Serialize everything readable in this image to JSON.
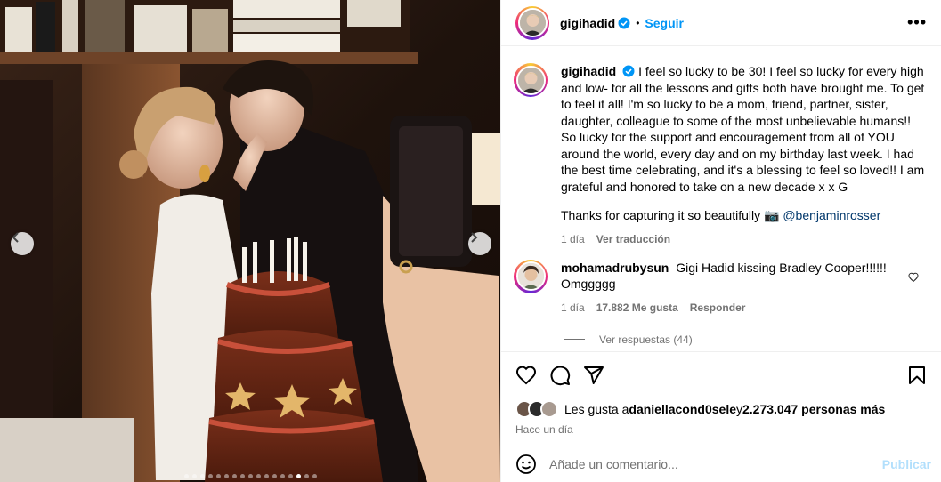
{
  "post": {
    "username": "gigihadid",
    "follow_label": "Seguir",
    "more_label": "•••",
    "caption": "I feel so lucky to be 30! I feel so lucky for every high and low- for all the lessons and gifts both have brought me. To get to feel it all! I'm so lucky to be a mom, friend, partner, sister, daughter, colleague to some of the most unbelievable humans!! So lucky for the support and encouragement from all of YOU around the world, every day and on my birthday last week. I had the best time celebrating, and it's a blessing to feel so loved!! I am grateful and honored to take on a new decade x x G",
    "thanks_text": "Thanks for capturing it so beautifully 📷 ",
    "mention": "@benjaminrosser",
    "caption_age": "1 día",
    "translate_label": "Ver traducción"
  },
  "comment": {
    "username": "mohamadrubysun",
    "text": "Gigi Hadid kissing Bradley Cooper!!!!!! Omggggg",
    "age": "1 día",
    "likes": "17.882 Me gusta",
    "reply_label": "Responder",
    "replies_label": "Ver respuestas (44)"
  },
  "likes": {
    "prefix": "Les gusta a ",
    "first_user": "daniellacond0sele",
    "middle": " y ",
    "count": "2.273.047 personas más"
  },
  "timestamp": "Hace un día",
  "add_comment": {
    "placeholder": "Añade un comentario...",
    "publish_label": "Publicar"
  },
  "carousel": {
    "slide_count": 17,
    "active_index": 14
  },
  "colors": {
    "accent": "#0095f6",
    "mention": "#00376b",
    "muted": "#737373",
    "publish_disabled": "#b2dffc"
  },
  "icons": [
    "verified-badge-icon",
    "more-options-icon",
    "heart-icon",
    "comment-icon",
    "share-icon",
    "bookmark-icon",
    "emoji-icon",
    "chevron-left-icon",
    "chevron-right-icon"
  ]
}
